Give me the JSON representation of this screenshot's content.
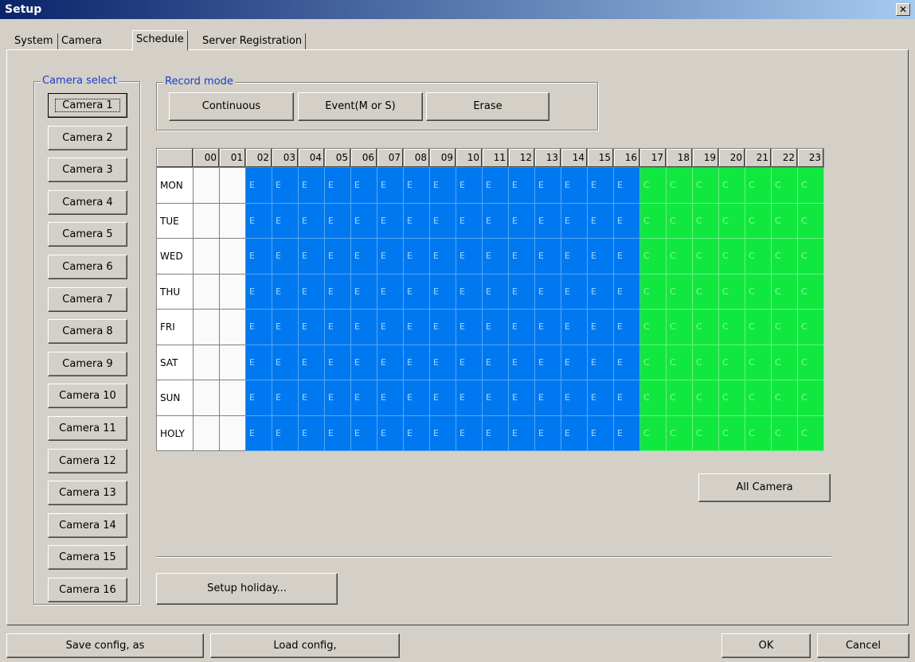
{
  "window": {
    "title": "Setup",
    "close_label": "✕"
  },
  "tabs": [
    "System",
    "Camera",
    "Schedule",
    "Server Registration"
  ],
  "active_tab": "Schedule",
  "camera_select": {
    "label": "Camera select",
    "cameras": [
      "Camera 1",
      "Camera 2",
      "Camera 3",
      "Camera 4",
      "Camera 5",
      "Camera 6",
      "Camera 7",
      "Camera 8",
      "Camera 9",
      "Camera 10",
      "Camera 11",
      "Camera 12",
      "Camera 13",
      "Camera 14",
      "Camera 15",
      "Camera 16"
    ],
    "selected": "Camera 1"
  },
  "record_mode": {
    "label": "Record mode",
    "continuous": "Continuous",
    "event": "Event(M or S)",
    "erase": "Erase"
  },
  "schedule": {
    "hours": [
      "00",
      "01",
      "02",
      "03",
      "04",
      "05",
      "06",
      "07",
      "08",
      "09",
      "10",
      "11",
      "12",
      "13",
      "14",
      "15",
      "16",
      "17",
      "18",
      "19",
      "20",
      "21",
      "22",
      "23"
    ],
    "days": [
      "MON",
      "TUE",
      "WED",
      "THU",
      "FRI",
      "SAT",
      "SUN",
      "HOLY"
    ],
    "hour_modes": [
      "",
      "",
      "E",
      "E",
      "E",
      "E",
      "E",
      "E",
      "E",
      "E",
      "E",
      "E",
      "E",
      "E",
      "E",
      "E",
      "E",
      "C",
      "C",
      "C",
      "C",
      "C",
      "C",
      "C"
    ],
    "colors": {
      "event": "#0078f0",
      "continuous": "#10e840",
      "empty": "#fafafa"
    }
  },
  "all_camera_label": "All Camera",
  "setup_holiday_label": "Setup holiday...",
  "footer": {
    "save": "Save config, as",
    "load": "Load config,",
    "ok": "OK",
    "cancel": "Cancel"
  }
}
